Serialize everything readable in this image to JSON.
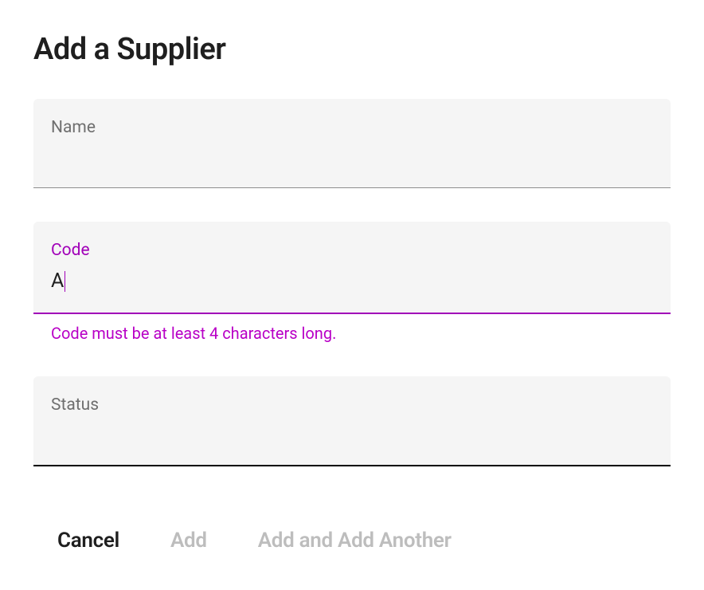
{
  "page": {
    "title": "Add a Supplier"
  },
  "fields": {
    "name": {
      "label": "Name",
      "value": ""
    },
    "code": {
      "label": "Code",
      "value": "A",
      "error": "Code must be at least 4 characters long."
    },
    "status": {
      "label": "Status",
      "value": ""
    }
  },
  "actions": {
    "cancel": "Cancel",
    "add": "Add",
    "addAnother": "Add and Add Another"
  }
}
